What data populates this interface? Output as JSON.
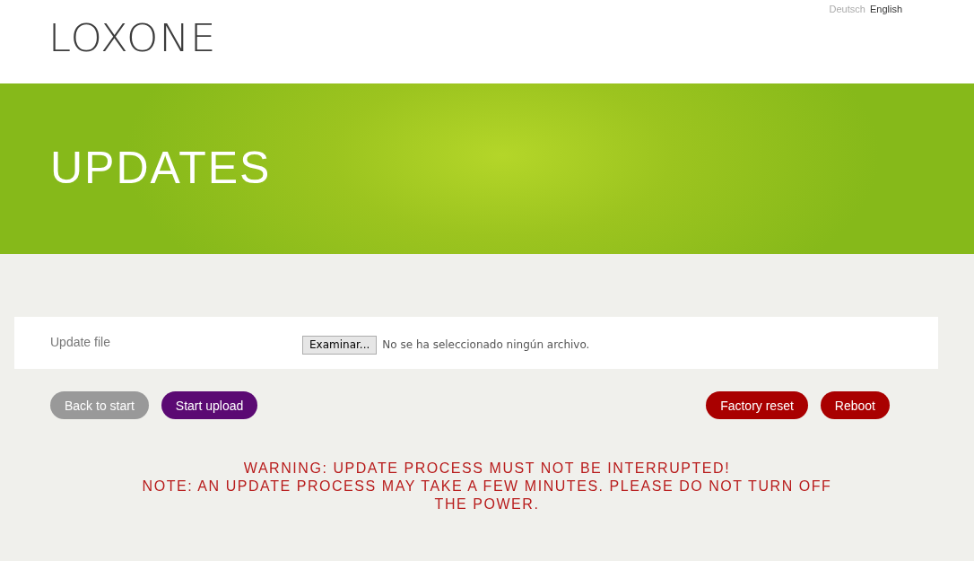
{
  "header": {
    "logo": "LOXONE",
    "languages": [
      {
        "label": "Deutsch",
        "selected": false
      },
      {
        "label": "English",
        "selected": true
      }
    ]
  },
  "banner": {
    "title": "UPDATES"
  },
  "form": {
    "label": "Update file",
    "browse_button": "Examinar...",
    "file_status": "No se ha seleccionado ningún archivo."
  },
  "buttons_left": [
    {
      "label": "Back to start",
      "kind": "neutral"
    },
    {
      "label": "Start upload",
      "kind": "primary"
    }
  ],
  "buttons_right": [
    {
      "label": "Factory reset",
      "kind": "danger"
    },
    {
      "label": "Reboot",
      "kind": "danger"
    }
  ],
  "messages": [
    "WARNING: UPDATE PROCESS MUST NOT BE INTERRUPTED!",
    "NOTE: AN UPDATE PROCESS MAY TAKE A FEW MINUTES. PLEASE DO NOT TURN OFF THE POWER."
  ]
}
